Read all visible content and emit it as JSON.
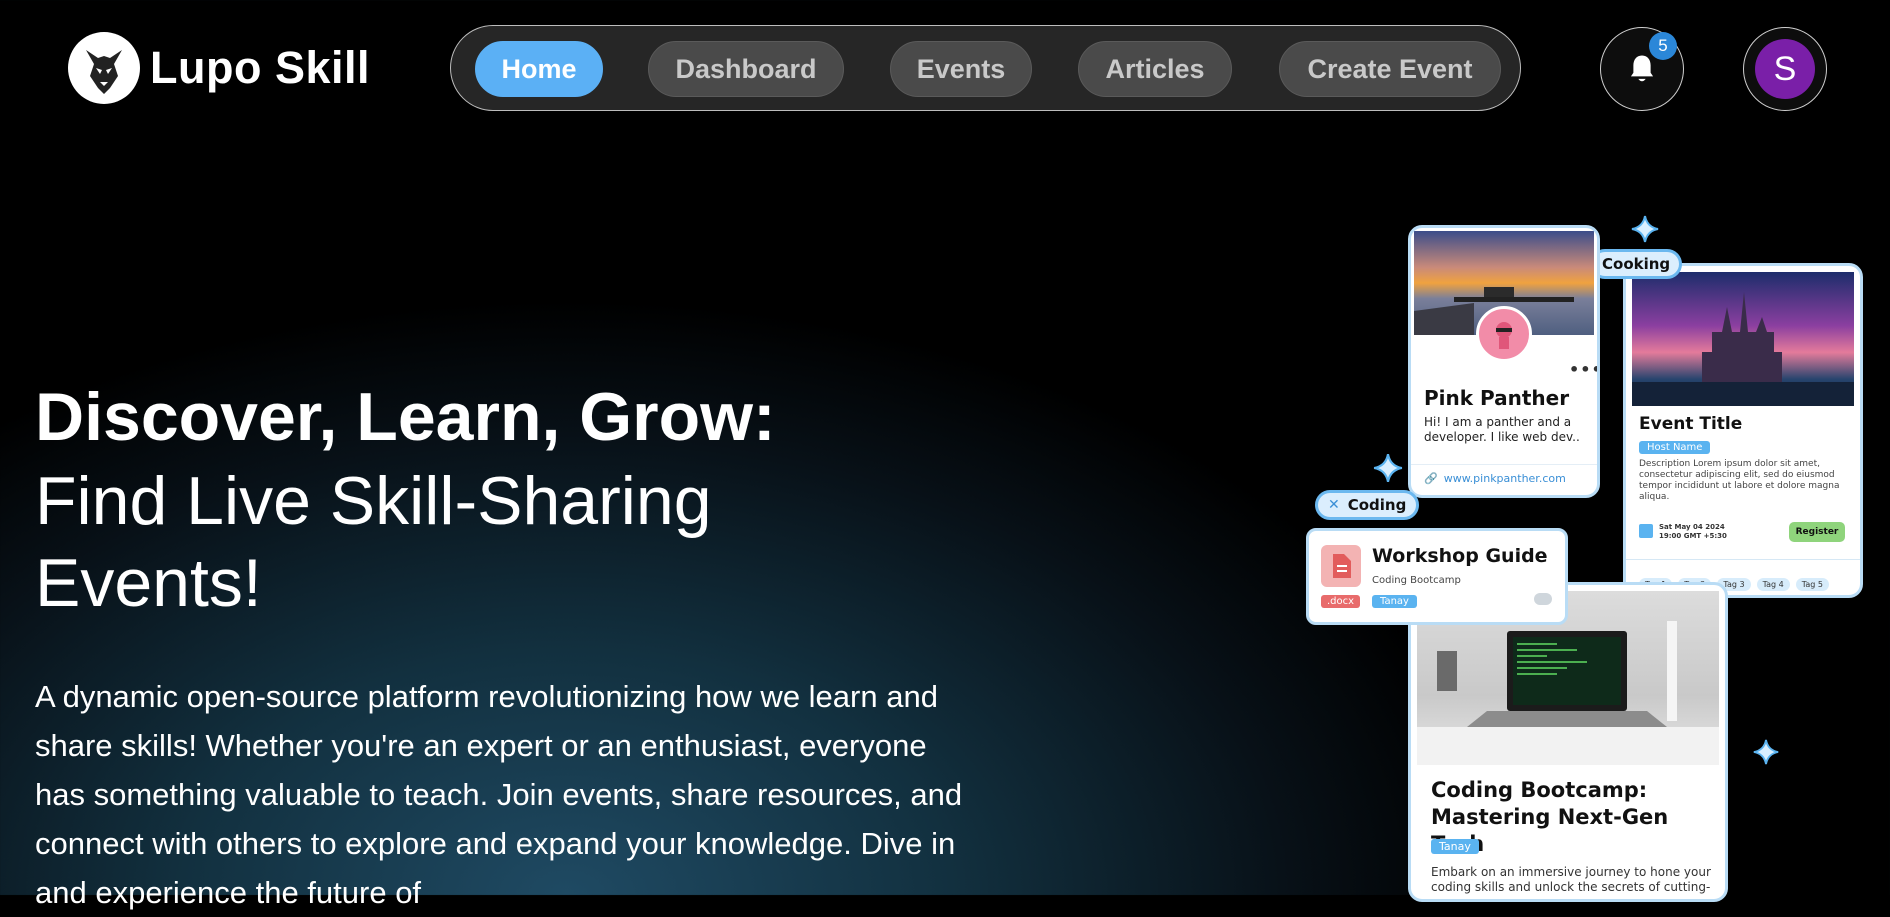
{
  "brand": {
    "name": "Lupo Skill",
    "logo_icon": "wolf-logo-icon"
  },
  "nav": {
    "items": [
      {
        "label": "Home",
        "active": true
      },
      {
        "label": "Dashboard",
        "active": false
      },
      {
        "label": "Events",
        "active": false
      },
      {
        "label": "Articles",
        "active": false
      },
      {
        "label": "Create Event",
        "active": false
      }
    ]
  },
  "notifications": {
    "count": "5",
    "icon": "bell-icon"
  },
  "user": {
    "initial": "S",
    "avatar_color": "#7a1fa8"
  },
  "hero": {
    "title_bold": "Discover, Learn, Grow:",
    "title_light": "Find Live Skill-Sharing Events!",
    "description": "A dynamic open-source platform revolutionizing how we learn and share skills! Whether you're an expert or an enthusiast, everyone has something valuable to teach. Join events, share resources, and connect with others to explore and expand your knowledge. Dive in and experience the future of"
  },
  "showcase": {
    "floating_tags": {
      "cooking": "Cooking",
      "coding": "Coding"
    },
    "profile_card": {
      "name": "Pink Panther",
      "bio": "Hi! I am a panther and a developer. I like web dev..",
      "link": "www.pinkpanther.com"
    },
    "event_card": {
      "title": "Event Title",
      "host": "Host Name",
      "description": "Description Lorem ipsum dolor sit amet, consectetur adipiscing elit, sed do eiusmod tempor incididunt ut labore et dolore magna aliqua.",
      "date": "Sat May 04 2024",
      "time": "19:00 GMT +5:30",
      "register_label": "Register",
      "tags": [
        "Tag 1",
        "Tag 2",
        "Tag 3",
        "Tag 4",
        "Tag 5"
      ]
    },
    "resource_card": {
      "title": "Workshop Guide",
      "subtitle": "Coding Bootcamp",
      "file_type": ".docx",
      "author": "Tanay"
    },
    "article_card": {
      "title": "Coding Bootcamp: Mastering Next-Gen Tech",
      "author": "Tanay",
      "excerpt": "Embark on an immersive journey to hone your coding skills and unlock the secrets of cutting-"
    }
  },
  "colors": {
    "accent": "#5bb0f5",
    "card_border": "#b9dcf5",
    "register_green": "#8fd47c"
  }
}
